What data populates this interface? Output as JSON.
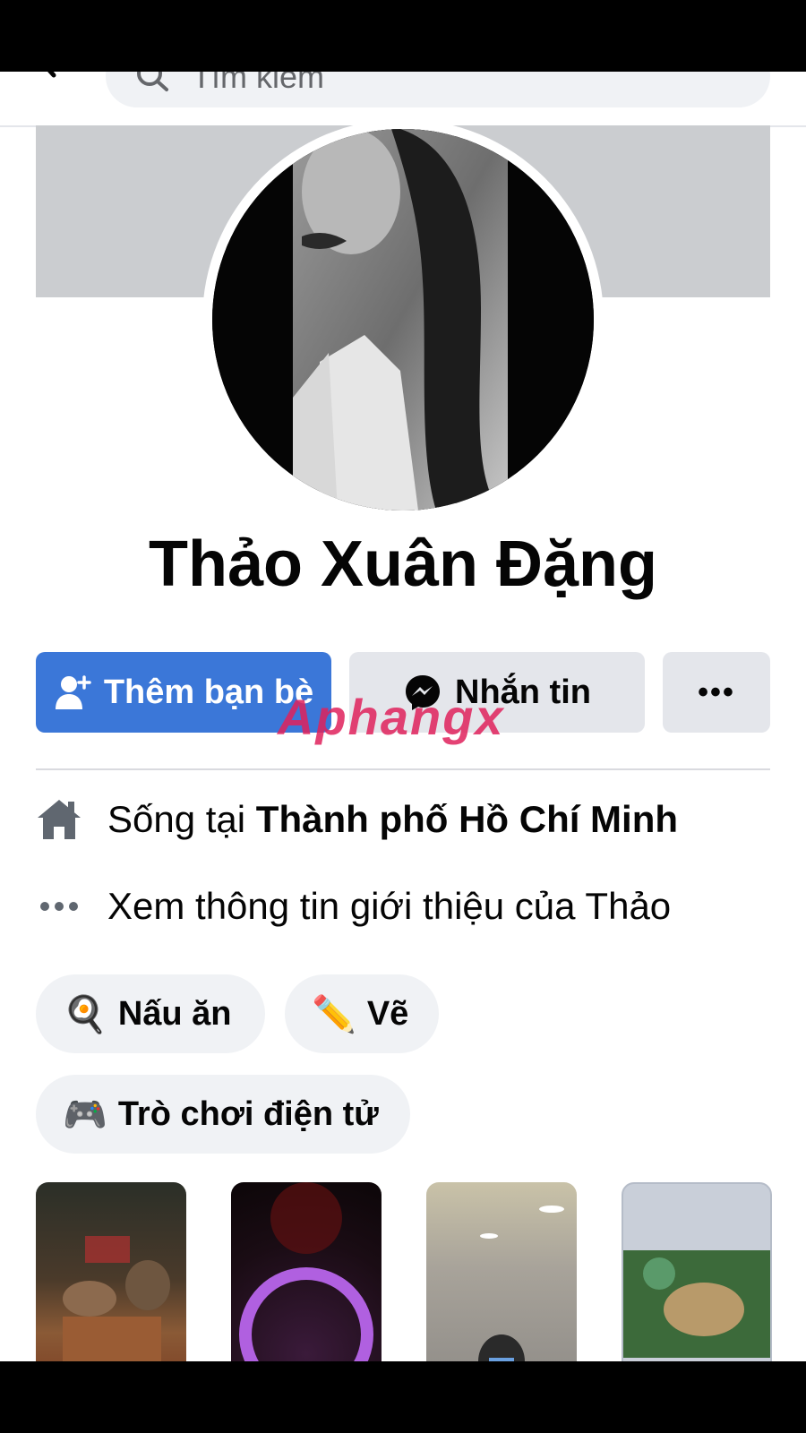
{
  "search": {
    "placeholder": "Tìm kiếm"
  },
  "profile": {
    "name": "Thảo Xuân Đặng"
  },
  "actions": {
    "add_friend_label": "Thêm bạn bè",
    "message_label": "Nhắn tin",
    "more_label": "•••"
  },
  "intro": {
    "lives_prefix": "Sống tại ",
    "lives_city": "Thành phố Hồ Chí Minh",
    "see_about": "Xem thông tin giới thiệu của Thảo"
  },
  "hobbies": [
    {
      "emoji": "🍳",
      "label": "Nấu ăn"
    },
    {
      "emoji": "✏️",
      "label": "Vẽ"
    },
    {
      "emoji": "🎮",
      "label": "Trò chơi điện tử"
    }
  ],
  "watermark": {
    "text": "Aphangx"
  },
  "colors": {
    "primary": "#3b77d8",
    "button_gray": "#e4e6eb",
    "chip_bg": "#f0f2f5"
  }
}
